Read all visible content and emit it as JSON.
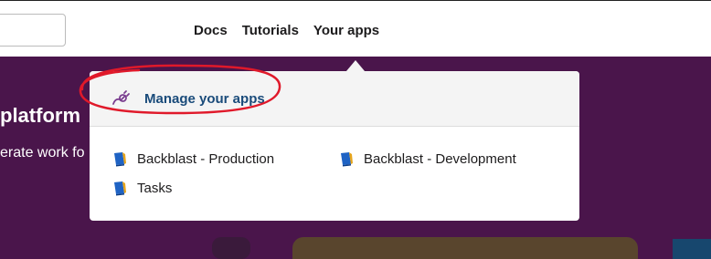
{
  "nav": {
    "docs": "Docs",
    "tutorials": "Tutorials",
    "your_apps": "Your apps"
  },
  "hero": {
    "title": "platform",
    "subtitle": "erate work fo"
  },
  "dropdown": {
    "manage_label": "Manage your apps",
    "apps": [
      {
        "label": "Backblast - Production",
        "icon": "app-book-icon"
      },
      {
        "label": "Backblast - Development",
        "icon": "app-book-icon"
      },
      {
        "label": "Tasks",
        "icon": "app-book-icon"
      }
    ]
  },
  "colors": {
    "hero_bg": "#4a154b",
    "link_blue": "#1a4b7a",
    "highlight_red": "#e0192a",
    "plug_purple": "#7a3d8f"
  }
}
